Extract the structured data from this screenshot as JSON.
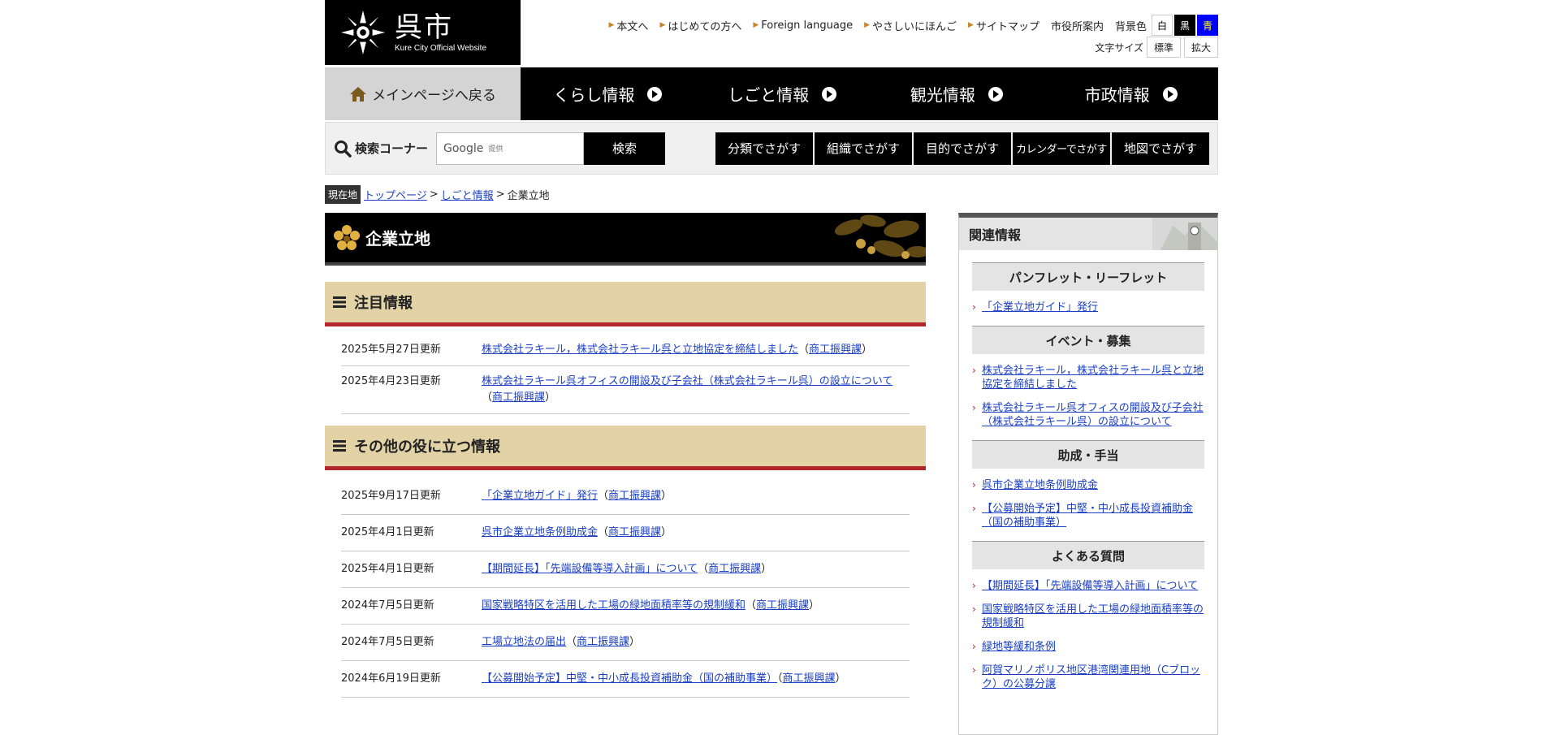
{
  "header": {
    "logo_name": "呉市",
    "logo_sub": "Kure City Official Website",
    "util_links": [
      "本文へ",
      "はじめての方へ",
      "Foreign language",
      "やさしいにほんご",
      "サイトマップ"
    ],
    "office_link": "市役所案内",
    "bg_label": "背景色",
    "bg_white": "白",
    "bg_black": "黒",
    "bg_blue": "青",
    "font_label": "文字サイズ",
    "font_normal": "標準",
    "font_large": "拡大"
  },
  "nav": {
    "home": "メインページへ戻る",
    "items": [
      "くらし情報",
      "しごと情報",
      "観光情報",
      "市政情報"
    ]
  },
  "search": {
    "label": "検索コーナー",
    "placeholder": "Google",
    "provided": "提供",
    "button": "検索",
    "find": [
      "分類でさがす",
      "組織でさがす",
      "目的でさがす",
      "カレンダーでさがす",
      "地図でさがす"
    ]
  },
  "breadcrumb": {
    "tag": "現在地",
    "top": "トップページ",
    "work": "しごと情報",
    "current": "企業立地"
  },
  "page_title": "企業立地",
  "featured": {
    "title": "注目情報",
    "rows": [
      {
        "date": "2025年5月27日更新",
        "link": "株式会社ラキール，株式会社ラキール呉と立地協定を締結しました",
        "dept": "商工振興課"
      },
      {
        "date": "2025年4月23日更新",
        "link": "株式会社ラキール呉オフィスの開設及び子会社（株式会社ラキール呉）の設立について",
        "dept": "商工振興課"
      }
    ]
  },
  "other": {
    "title": "その他の役に立つ情報",
    "rows": [
      {
        "date": "2025年9月17日更新",
        "link": "「企業立地ガイド」発行",
        "dept": "商工振興課"
      },
      {
        "date": "2025年4月1日更新",
        "link": "呉市企業立地条例助成金",
        "dept": "商工振興課"
      },
      {
        "date": "2025年4月1日更新",
        "link": "【期間延長】「先端設備等導入計画」について",
        "dept": "商工振興課"
      },
      {
        "date": "2024年7月5日更新",
        "link": "国家戦略特区を活用した工場の緑地面積率等の規制緩和",
        "dept": "商工振興課"
      },
      {
        "date": "2024年7月5日更新",
        "link": "工場立地法の届出",
        "dept": "商工振興課"
      },
      {
        "date": "2024年6月19日更新",
        "link": "【公募開始予定】中堅・中小成長投資補助金（国の補助事業）",
        "dept": "商工振興課"
      }
    ]
  },
  "sidebar": {
    "title": "関連情報",
    "categories": [
      {
        "name": "パンフレット・リーフレット",
        "items": [
          "「企業立地ガイド」発行"
        ]
      },
      {
        "name": "イベント・募集",
        "items": [
          "株式会社ラキール，株式会社ラキール呉と立地協定を締結しました",
          "株式会社ラキール呉オフィスの開設及び子会社（株式会社ラキール呉）の設立について"
        ]
      },
      {
        "name": "助成・手当",
        "items": [
          "呉市企業立地条例助成金",
          "【公募開始予定】中堅・中小成長投資補助金（国の補助事業）"
        ]
      },
      {
        "name": "よくある質問",
        "items": [
          "【期間延長】「先端設備等導入計画」について",
          "国家戦略特区を活用した工場の緑地面積率等の規制緩和",
          "緑地等緩和条例",
          "阿賀マリノポリス地区港湾関連用地（Cブロック）の公募分譲"
        ]
      }
    ]
  },
  "colors": {
    "section_bg": "#e2d2a6",
    "section_border": "#b3262c",
    "link": "#1a3fc4",
    "nav_bg": "#000000"
  }
}
